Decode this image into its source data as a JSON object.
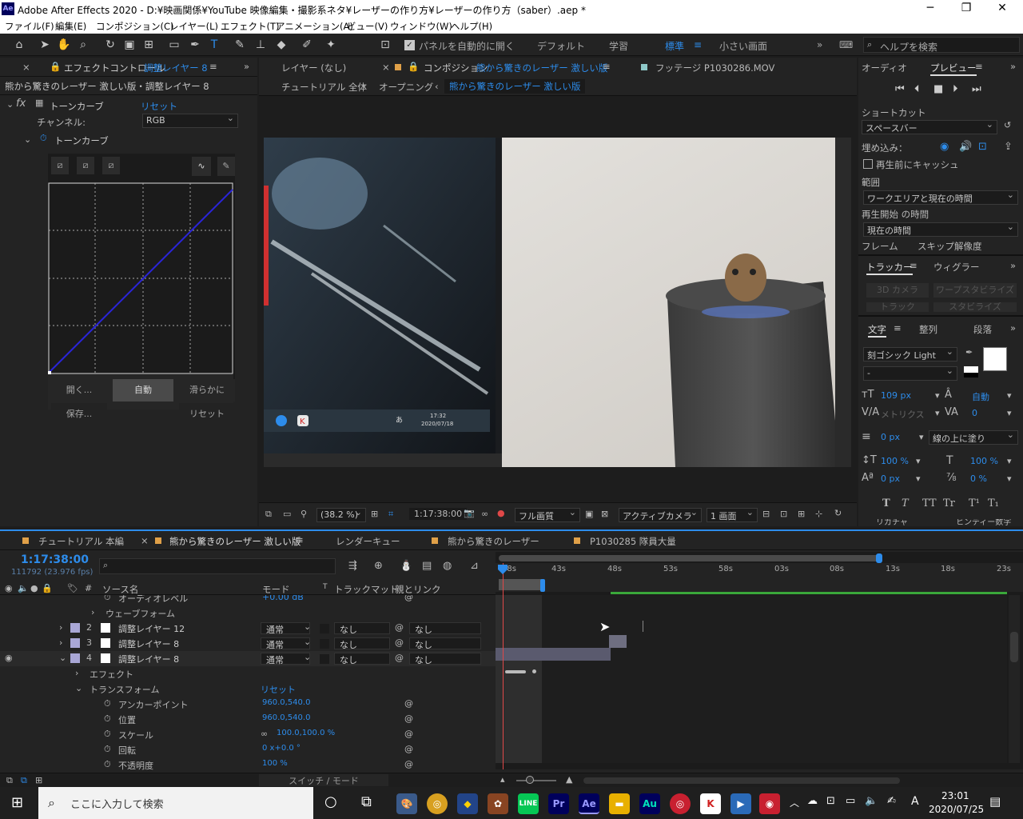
{
  "window": {
    "title": "Adobe After Effects 2020 - D:¥映画関係¥YouTube 映像編集・撮影系ネタ¥レーザーの作り方¥レーザーの作り方（saber）.aep *",
    "app_icon": "Ae",
    "controls": [
      "minimize-icon",
      "maximize-icon",
      "close-icon"
    ]
  },
  "menu": [
    "ファイル(F)",
    "編集(E)",
    "コンポジション(C)",
    "レイヤー(L)",
    "エフェクト(T)",
    "アニメーション(A)",
    "ビュー(V)",
    "ウィンドウ(W)",
    "ヘルプ(H)"
  ],
  "toolbar": {
    "auto_open_label": "パネルを自動的に開く",
    "workspaces": [
      "デフォルト",
      "学習",
      "標準",
      "小さい画面"
    ],
    "active_workspace": "標準",
    "help_placeholder": "ヘルプを検索"
  },
  "effect_controls": {
    "tab_prefix": "エフェクトコントロール",
    "tab_layer": "調整レイヤー 8",
    "header": "熊から驚きのレーザー 激しい版・調整レイヤー 8",
    "fx_name": "トーンカーブ",
    "reset": "リセット",
    "channel_label": "チャンネル:",
    "channel_value": "RGB",
    "curve_label": "トーンカーブ",
    "buttons": {
      "open": "開く...",
      "auto": "自動",
      "smooth": "滑らかに",
      "save": "保存...",
      "reset": "リセット"
    }
  },
  "comp_panel": {
    "layer_tab": "レイヤー (なし)",
    "comp_tab_prefix": "コンポジション",
    "comp_tab_name": "熊から驚きのレーザー 激しい版",
    "footage_tab": "フッテージ P1030286.MOV",
    "breadcrumbs": [
      "チュートリアル 全体",
      "オープニング",
      "熊から驚きのレーザー 激しい版"
    ],
    "screen_time": "17:32",
    "screen_date": "2020/07/18",
    "screen_ime": "あ",
    "zoom": "(38.2 %)",
    "timecode": "1:17:38:00",
    "quality": "フル画質",
    "camera": "アクティブカメラ",
    "views": "1 画面"
  },
  "right_panel": {
    "audio_tab": "オーディオ",
    "preview_tab": "プレビュー",
    "shortcut_label": "ショートカット",
    "shortcut_value": "スペースバー",
    "embed_label": "埋め込み：",
    "cache_label": "再生前にキャッシュ",
    "range_label": "範囲",
    "range_value": "ワークエリアと現在の時間",
    "start_label": "再生開始 の時間",
    "start_value": "現在の時間",
    "frame_label": "フレーム",
    "skip_label": "スキップ",
    "res_label": "解像度",
    "tracker_tab": "トラッカー",
    "wiggler_tab": "ウィグラー",
    "cam3d": "3D カメラ",
    "warp": "ワープスタビライズ",
    "track": "トラック",
    "stabilize": "スタビライズ",
    "text_tab": "文字",
    "align_tab": "整列",
    "para_tab": "段落",
    "font": "刻ゴシック Light",
    "font_style": "-",
    "size": "109 px",
    "leading": "自動",
    "kerning": "メトリクス",
    "tracking": "0",
    "stroke_width": "0 px",
    "stroke_type": "線の上に塗り",
    "vscale": "100 %",
    "hscale": "100 %",
    "baseline": "0 px",
    "tsume": "0 %",
    "type_styles": [
      "T",
      "T",
      "TT",
      "Tr",
      "T¹",
      "T₁"
    ],
    "bottom_labels": [
      "リガチャ",
      "ヒンディー数字"
    ]
  },
  "timeline": {
    "tabs": [
      "チュートリアル 本編",
      "熊から驚きのレーザー 激しい版",
      "レンダーキュー",
      "熊から驚きのレーザー",
      "P1030285 隊員大量"
    ],
    "active_tab": "熊から驚きのレーザー 激しい版",
    "timecode": "1:17:38:00",
    "frames": "111792 (23.976 fps)",
    "cols": {
      "hash": "#",
      "source": "ソース名",
      "mode": "モード",
      "t": "T",
      "trackmatte": "トラックマット",
      "parent": "親とリンク"
    },
    "ruler": [
      "38s",
      "43s",
      "48s",
      "53s",
      "58s",
      "03s",
      "08s",
      "13s",
      "18s",
      "23s"
    ],
    "rows": {
      "audio_level": "オーディオレベル",
      "audio_value": "+0.00 dB",
      "waveform": "ウェーブフォーム",
      "layers": [
        {
          "num": "2",
          "name": "調整レイヤー 12",
          "mode": "通常",
          "matte": "なし",
          "parent": "なし"
        },
        {
          "num": "3",
          "name": "調整レイヤー 8",
          "mode": "通常",
          "matte": "なし",
          "parent": "なし"
        },
        {
          "num": "4",
          "name": "調整レイヤー 8",
          "mode": "通常",
          "matte": "なし",
          "parent": "なし"
        }
      ],
      "effect": "エフェクト",
      "transform": "トランスフォーム",
      "transform_reset": "リセット",
      "props": [
        {
          "name": "アンカーポイント",
          "value": "960.0,540.0"
        },
        {
          "name": "位置",
          "value": "960.0,540.0"
        },
        {
          "name": "スケール",
          "value": "100.0,100.0 %"
        },
        {
          "name": "回転",
          "value": "0 x+0.0 °"
        },
        {
          "name": "不透明度",
          "value": "100 %"
        }
      ]
    },
    "switch_mode": "スイッチ / モード"
  },
  "taskbar": {
    "search_placeholder": "ここに入力して検索",
    "apps": [
      "Pr",
      "Ae",
      "Au"
    ],
    "time": "23:01",
    "date": "2020/07/25",
    "ime": "A"
  }
}
